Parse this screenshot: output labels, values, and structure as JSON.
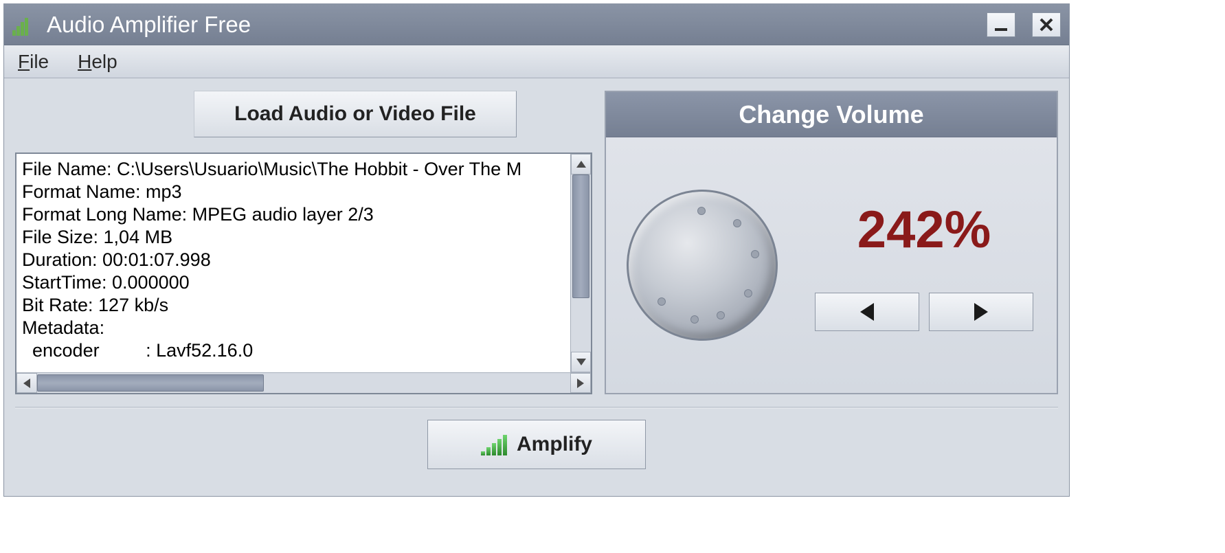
{
  "window": {
    "title": "Audio Amplifier Free"
  },
  "menu": {
    "file": "File",
    "help": "Help"
  },
  "buttons": {
    "load": "Load Audio or Video File",
    "amplify": "Amplify"
  },
  "volume_panel": {
    "header": "Change Volume",
    "percent": "242%"
  },
  "info": {
    "lines": [
      "File Name: C:\\Users\\Usuario\\Music\\The Hobbit - Over The M",
      "Format Name: mp3",
      "Format Long Name: MPEG audio layer 2/3",
      "File Size: 1,04 MB",
      "Duration: 00:01:07.998",
      "StartTime: 0.000000",
      "Bit Rate: 127 kb/s",
      "Metadata:",
      "  encoder         : Lavf52.16.0"
    ]
  }
}
